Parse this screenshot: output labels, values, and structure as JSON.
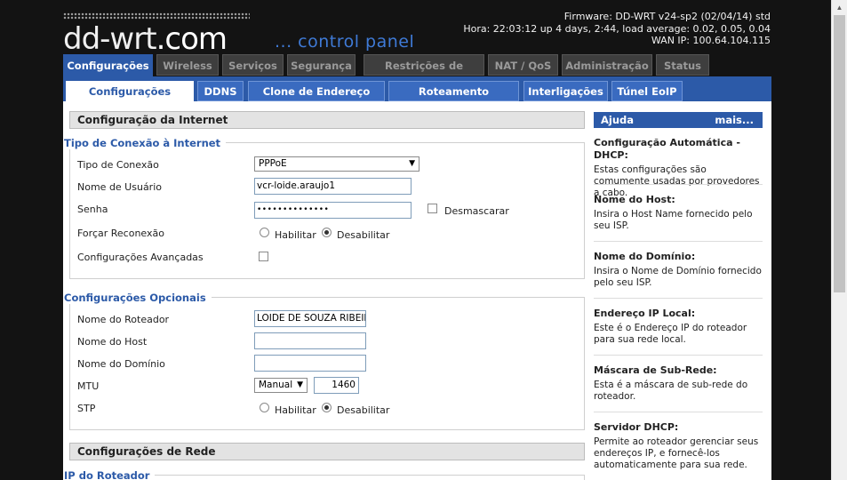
{
  "header": {
    "logo_text": "dd-wrt",
    "logo_suffix": ".com",
    "tagline": "... control panel",
    "firmware": "Firmware: DD-WRT v24-sp2 (02/04/14) std",
    "time": "Hora: 22:03:12 up 4 days, 2:44, load average: 0.02, 0.05, 0.04",
    "wan_ip": "WAN IP: 100.64.104.115"
  },
  "main_tabs": [
    {
      "label": "Configurações",
      "active": true
    },
    {
      "label": "Wireless"
    },
    {
      "label": "Serviços"
    },
    {
      "label": "Segurança"
    },
    {
      "label": "Restrições de Acesso"
    },
    {
      "label": "NAT / QoS"
    },
    {
      "label": "Administração"
    },
    {
      "label": "Status"
    }
  ],
  "sub_tabs": [
    {
      "label": "Configurações Básicas",
      "active": true
    },
    {
      "label": "DDNS"
    },
    {
      "label": "Clone de Endereço MAC"
    },
    {
      "label": "Roteamento Avançado"
    },
    {
      "label": "Interligações"
    },
    {
      "label": "Túnel EoIP"
    }
  ],
  "internet": {
    "section_title": "Configuração da Internet",
    "legend": "Tipo de Conexão à Internet",
    "connection_type_label": "Tipo de Conexão",
    "connection_type_value": "PPPoE",
    "username_label": "Nome de Usuário",
    "username_value": "vcr-loide.araujo1",
    "password_label": "Senha",
    "password_value": "••••••••••••••",
    "unmask_label": "Desmascarar",
    "reconnect_label": "Forçar Reconexão",
    "enable_label": "Habilitar",
    "disable_label": "Desabilitar",
    "advanced_label": "Configurações Avançadas"
  },
  "optional": {
    "legend": "Configurações Opcionais",
    "router_name_label": "Nome do Roteador",
    "router_name_value": "LOIDE DE SOUZA RIBEIR",
    "host_name_label": "Nome do Host",
    "host_name_value": "",
    "domain_name_label": "Nome do Domínio",
    "domain_name_value": "",
    "mtu_label": "MTU",
    "mtu_mode": "Manual",
    "mtu_value": "1460",
    "stp_label": "STP",
    "enable_label": "Habilitar",
    "disable_label": "Desabilitar"
  },
  "network": {
    "section_title": "Configurações de Rede",
    "legend": "IP do Roteador"
  },
  "help": {
    "title": "Ajuda",
    "more": "mais...",
    "items": [
      {
        "title": "Configuração Automática - DHCP:",
        "text": "Estas configurações são comumente usadas por provedores a cabo."
      },
      {
        "title": "Nome do Host:",
        "text": "Insira o Host Name fornecido pelo seu ISP."
      },
      {
        "title": "Nome do Domínio:",
        "text": "Insira o Nome de Domínio fornecido pelo seu ISP."
      },
      {
        "title": "Endereço IP Local:",
        "text": "Este é o Endereço IP do roteador para sua rede local."
      },
      {
        "title": "Máscara de Sub-Rede:",
        "text": "Esta é a máscara de sub-rede do roteador."
      },
      {
        "title": "Servidor DHCP:",
        "text": "Permite ao roteador gerenciar seus endereços IP, e fornecê-los automaticamente para sua rede."
      }
    ]
  },
  "colors": {
    "accent": "#2c5aa8",
    "background": "#131313",
    "tagline": "#3f7ad6"
  }
}
